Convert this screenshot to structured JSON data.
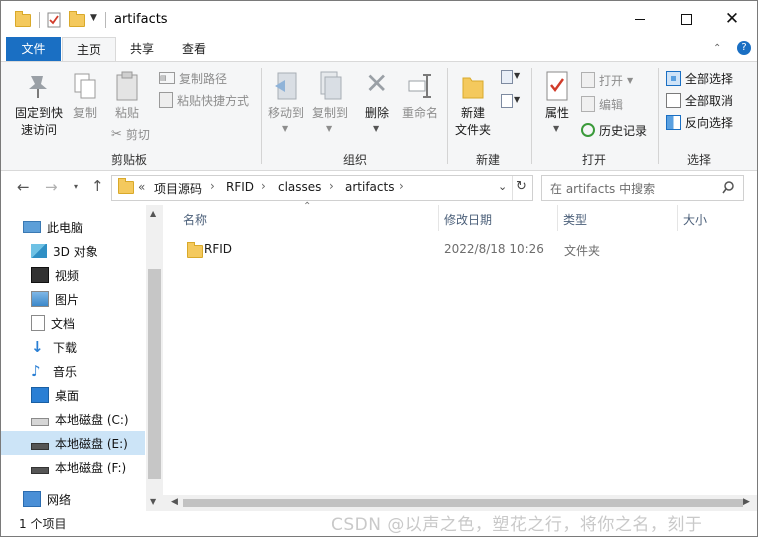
{
  "window": {
    "title": "artifacts"
  },
  "ribbon_tabs": [
    "文件",
    "主页",
    "共享",
    "查看"
  ],
  "ribbon": {
    "clipboard": {
      "pin": "固定到快",
      "pin2": "速访问",
      "copy": "复制",
      "paste": "粘贴",
      "copy_path": "复制路径",
      "paste_shortcut": "粘贴快捷方式",
      "cut": "剪切",
      "group": "剪贴板"
    },
    "organize": {
      "move_to": "移动到",
      "copy_to": "复制到",
      "delete": "删除",
      "rename": "重命名",
      "group": "组织"
    },
    "new": {
      "new_folder": "新建",
      "new_folder2": "文件夹",
      "group": "新建"
    },
    "open": {
      "properties": "属性",
      "open": "打开",
      "edit": "编辑",
      "history": "历史记录",
      "group": "打开"
    },
    "select": {
      "select_all": "全部选择",
      "select_none": "全部取消",
      "invert": "反向选择",
      "group": "选择"
    }
  },
  "address": {
    "overflow": "«",
    "crumbs": [
      "项目源码",
      "RFID",
      "classes",
      "artifacts"
    ]
  },
  "search": {
    "placeholder": "在 artifacts 中搜索"
  },
  "nav_pane": [
    {
      "label": "此电脑",
      "icon": "pc-icon"
    },
    {
      "label": "3D 对象",
      "icon": "3d-objects-icon"
    },
    {
      "label": "视频",
      "icon": "video-icon"
    },
    {
      "label": "图片",
      "icon": "pictures-icon"
    },
    {
      "label": "文档",
      "icon": "documents-icon"
    },
    {
      "label": "下载",
      "icon": "downloads-icon"
    },
    {
      "label": "音乐",
      "icon": "music-icon"
    },
    {
      "label": "桌面",
      "icon": "desktop-icon"
    },
    {
      "label": "本地磁盘 (C:)",
      "icon": "drive-c-icon"
    },
    {
      "label": "本地磁盘 (E:)",
      "icon": "drive-e-icon",
      "selected": true
    },
    {
      "label": "本地磁盘 (F:)",
      "icon": "drive-f-icon"
    },
    {
      "label": "网络",
      "icon": "network-icon"
    }
  ],
  "columns": {
    "name": "名称",
    "date": "修改日期",
    "type": "类型",
    "size": "大小"
  },
  "files": [
    {
      "name": "RFID",
      "date": "2022/8/18 10:26",
      "type": "文件夹",
      "size": ""
    }
  ],
  "status": {
    "count": "1 个项目"
  },
  "watermark": "CSDN @以声之色，塑花之行，将你之名，刻于"
}
